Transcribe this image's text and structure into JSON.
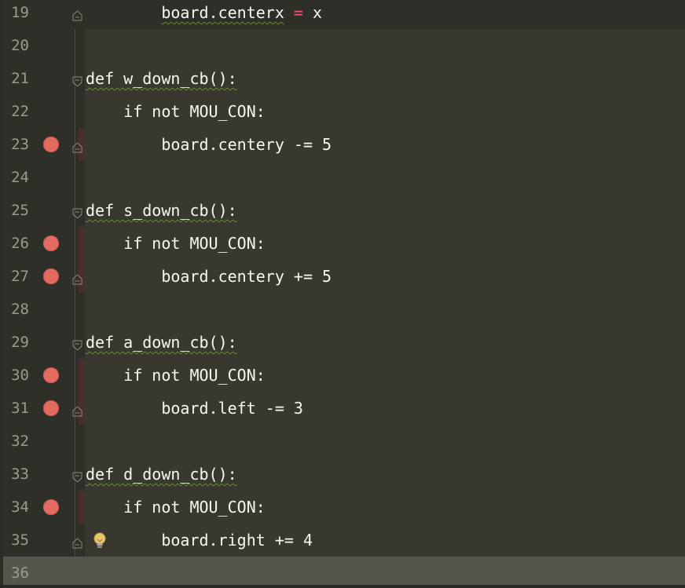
{
  "editor": {
    "language": "python",
    "theme_colors": {
      "background": "#383830",
      "gutter": "#2f2f2a",
      "caret_line": "#55554c",
      "line_number": "#9a9a90",
      "code_text": "#f8f8f2",
      "operator_red": "#f2557a",
      "breakpoint": "#e46b62"
    },
    "lines": [
      {
        "num": "19",
        "indent": "        ",
        "text": "board.centerx",
        "op": " = ",
        "rest": "x",
        "breakpoint": false,
        "fold": "end"
      },
      {
        "num": "20",
        "indent": "",
        "text": "",
        "breakpoint": false,
        "fold": "none"
      },
      {
        "num": "21",
        "indent": "",
        "text": "def w_down_cb():",
        "breakpoint": false,
        "fold": "start"
      },
      {
        "num": "22",
        "indent": "    ",
        "text": "if not MOU_CON:",
        "breakpoint": false,
        "fold": "none"
      },
      {
        "num": "23",
        "indent": "        ",
        "text": "board.centery -= 5",
        "breakpoint": true,
        "fold": "end"
      },
      {
        "num": "24",
        "indent": "",
        "text": "",
        "breakpoint": false,
        "fold": "none"
      },
      {
        "num": "25",
        "indent": "",
        "text": "def s_down_cb():",
        "breakpoint": false,
        "fold": "start"
      },
      {
        "num": "26",
        "indent": "    ",
        "text": "if not MOU_CON:",
        "breakpoint": true,
        "fold": "none"
      },
      {
        "num": "27",
        "indent": "        ",
        "text": "board.centery += 5",
        "breakpoint": true,
        "fold": "end"
      },
      {
        "num": "28",
        "indent": "",
        "text": "",
        "breakpoint": false,
        "fold": "none"
      },
      {
        "num": "29",
        "indent": "",
        "text": "def a_down_cb():",
        "breakpoint": false,
        "fold": "start"
      },
      {
        "num": "30",
        "indent": "    ",
        "text": "if not MOU_CON:",
        "breakpoint": true,
        "fold": "none"
      },
      {
        "num": "31",
        "indent": "        ",
        "text": "board.left -= 3",
        "breakpoint": true,
        "fold": "end"
      },
      {
        "num": "32",
        "indent": "",
        "text": "",
        "breakpoint": false,
        "fold": "none"
      },
      {
        "num": "33",
        "indent": "",
        "text": "def d_down_cb():",
        "breakpoint": false,
        "fold": "start"
      },
      {
        "num": "34",
        "indent": "    ",
        "text": "if not MOU_CON:",
        "breakpoint": true,
        "fold": "none"
      },
      {
        "num": "35",
        "indent": "        ",
        "text": "board.right += 4",
        "breakpoint": false,
        "fold": "end",
        "intention_bulb": true
      },
      {
        "num": "36",
        "indent": "",
        "text": "",
        "breakpoint": false,
        "fold": "none",
        "caret_line": true
      }
    ]
  },
  "icons": {
    "breakpoint": "breakpoint-icon",
    "fold": "fold-marker-icon",
    "bulb": "lightbulb-icon"
  }
}
